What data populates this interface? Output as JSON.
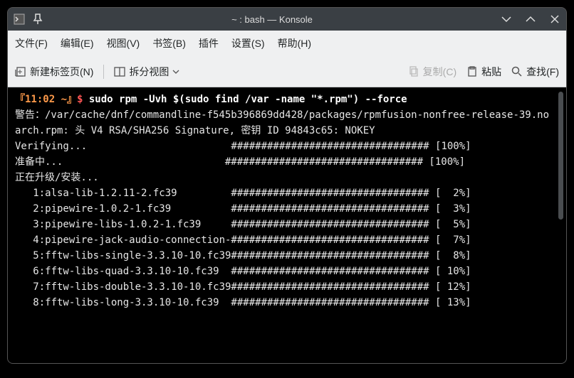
{
  "window": {
    "title": "~ : bash — Konsole"
  },
  "menubar": {
    "file": "文件(F)",
    "edit": "编辑(E)",
    "view": "视图(V)",
    "bookmarks": "书签(B)",
    "plugins": "插件",
    "settings": "设置(S)",
    "help": "帮助(H)"
  },
  "toolbar": {
    "new_tab": "新建标签页(N)",
    "split_view": "拆分视图",
    "copy": "复制(C)",
    "paste": "粘贴",
    "find": "查找(F)"
  },
  "terminal": {
    "prompt_time": "『11:02 ~』$ ",
    "command": "sudo rpm -Uvh $(sudo find /var -name \"*.rpm\") --force",
    "warn1": "警告：/var/cache/dnf/commandline-f545b396869dd428/packages/rpmfusion-nonfree-release-39.no",
    "warn2": "arch.rpm: 头 V4 RSA/SHA256 Signature, 密钥 ID 94843c65: NOKEY",
    "verify_label": "Verifying...",
    "verify_hash": "################################# [100%]",
    "prepare_label": "准备中...",
    "prepare_hash": "################################# [100%]",
    "upgrading": "正在升级/安装...",
    "packages": [
      {
        "idx": "1",
        "name": "alsa-lib-1.2.11-2.fc39",
        "pct": "2%"
      },
      {
        "idx": "2",
        "name": "pipewire-1.0.2-1.fc39",
        "pct": "3%"
      },
      {
        "idx": "3",
        "name": "pipewire-libs-1.0.2-1.fc39",
        "pct": "5%"
      },
      {
        "idx": "4",
        "name": "pipewire-jack-audio-connection-ki",
        "pct": "7%"
      },
      {
        "idx": "5",
        "name": "fftw-libs-single-3.3.10-10.fc39",
        "pct": "8%"
      },
      {
        "idx": "6",
        "name": "fftw-libs-quad-3.3.10-10.fc39",
        "pct": "10%"
      },
      {
        "idx": "7",
        "name": "fftw-libs-double-3.3.10-10.fc39",
        "pct": "12%"
      },
      {
        "idx": "8",
        "name": "fftw-libs-long-3.3.10-10.fc39",
        "pct": "13%"
      }
    ]
  }
}
